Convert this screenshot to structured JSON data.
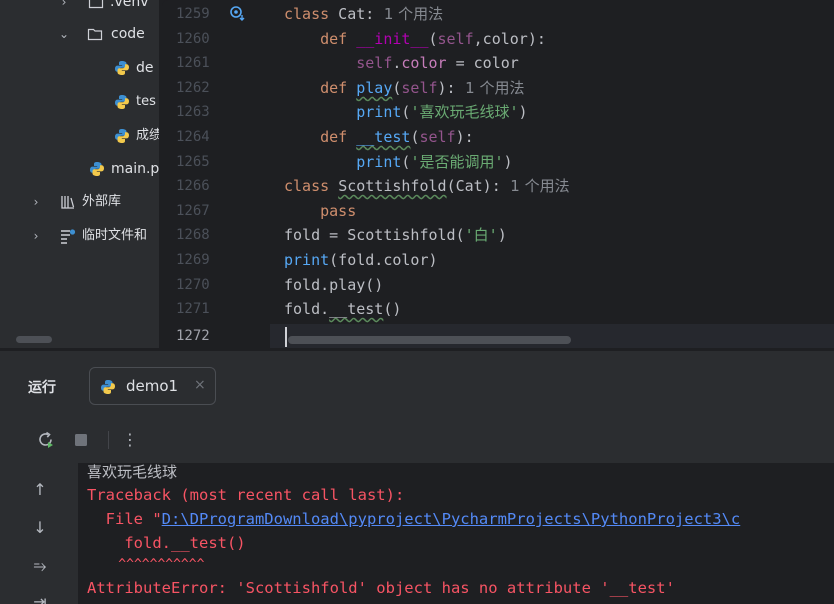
{
  "project_tree": {
    "items": [
      {
        "label": ".venv",
        "chevron": "›",
        "icon": "folder-icon"
      },
      {
        "label": "code",
        "chevron": "⌄",
        "icon": "folder-icon"
      },
      {
        "label": "de",
        "icon": "python-file-icon"
      },
      {
        "label": "tes",
        "icon": "python-file-icon"
      },
      {
        "label": "成绩",
        "icon": "python-file-icon"
      },
      {
        "label": "main.p",
        "icon": "python-file-icon"
      },
      {
        "label": "外部库",
        "chevron": "›",
        "icon": "library-icon"
      },
      {
        "label": "临时文件和",
        "chevron": "›",
        "icon": "scratch-icon"
      }
    ]
  },
  "editor": {
    "line_numbers": [
      "1259",
      "1260",
      "1261",
      "1262",
      "1263",
      "1264",
      "1265",
      "1266",
      "1267",
      "1268",
      "1269",
      "1270",
      "1271",
      "1272"
    ],
    "current_line": "1272",
    "code": {
      "l1259": {
        "kw": "class",
        "name": " Cat:",
        "hint": "  1 个用法"
      },
      "l1260": {
        "indent": "    ",
        "kw": "def",
        "sp": " ",
        "fn": "__init__",
        "open": "(",
        "self": "self",
        "rest": ",color):"
      },
      "l1261": {
        "indent": "        ",
        "self": "self",
        "dot": ".",
        "field": "color",
        "rest": " = color"
      },
      "l1262": {
        "indent": "    ",
        "kw": "def",
        "sp": " ",
        "fn": "play",
        "open": "(",
        "self": "self",
        "rest": "):",
        "hint": "  1 个用法"
      },
      "l1263": {
        "indent": "        ",
        "fn": "print",
        "open": "(",
        "str": "'喜欢玩毛线球'",
        "close": ")"
      },
      "l1264": {
        "indent": "    ",
        "kw": "def",
        "sp": " ",
        "fn": "__test",
        "open": "(",
        "self": "self",
        "rest": "):"
      },
      "l1265": {
        "indent": "        ",
        "fn": "print",
        "open": "(",
        "str": "'是否能调用'",
        "close": ")"
      },
      "l1266": {
        "kw": "class",
        "sp": " ",
        "name": "Scottishfold",
        "rest": "(Cat):",
        "hint": "  1 个用法"
      },
      "l1267": {
        "indent": "    ",
        "kw": "pass"
      },
      "l1268": {
        "pre": "fold = Scottishfold(",
        "str": "'白'",
        "close": ")"
      },
      "l1269": {
        "fn": "print",
        "rest": "(fold.color)"
      },
      "l1270": {
        "text": "fold.play()"
      },
      "l1271": {
        "pre": "fold.",
        "u": "__test",
        "rest": "()"
      }
    }
  },
  "run_window": {
    "title": "运行",
    "tab_label": "demo1",
    "tab_close": "×",
    "toolbar": {
      "rerun_icon": "rerun-icon",
      "stop_icon": "stop-icon",
      "more": "⋮"
    },
    "side_buttons": [
      "↑",
      "↓",
      "⥱",
      "⇥"
    ],
    "console": {
      "output_line": "喜欢玩毛线球",
      "traceback_header": "Traceback (most recent call last):",
      "file_prefix": "  File \"",
      "file_path": "D:\\DProgramDownload\\pyproject\\PycharmProjects\\PythonProject3\\c",
      "code_line": "    fold.__test()",
      "carets": "    ^^^^^^^^^^^",
      "error": "AttributeError: 'Scottishfold' object has no attribute '__test'"
    }
  },
  "colors": {
    "background": "#1e1f22",
    "panel": "#2b2d30",
    "keyword": "#cf8e6d",
    "function": "#56a8f5",
    "string": "#6aab73",
    "error": "#f75464",
    "link": "#548af7"
  }
}
